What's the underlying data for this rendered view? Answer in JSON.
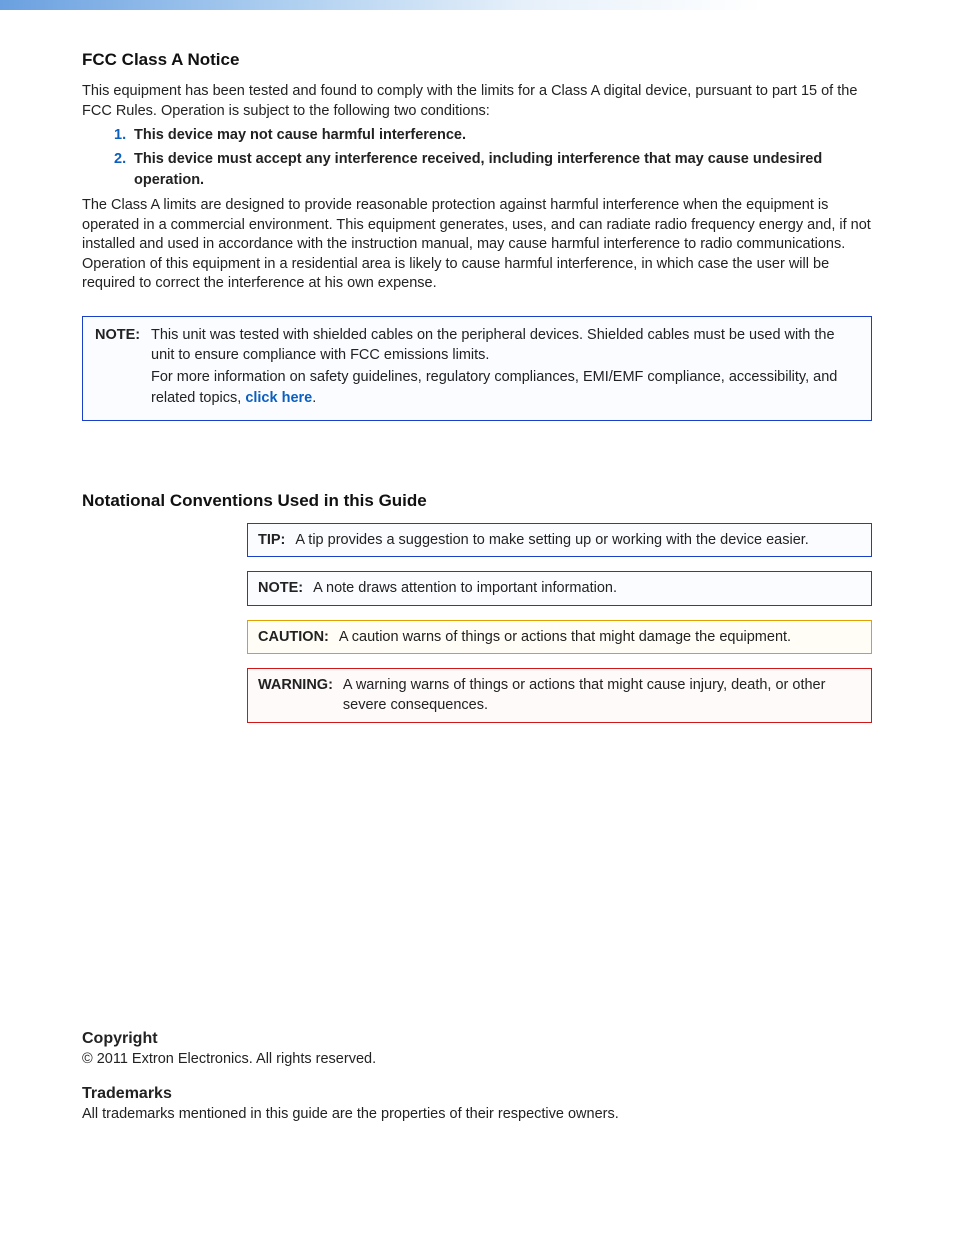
{
  "fcc": {
    "heading": "FCC Class A Notice",
    "intro": "This equipment has been tested and found to comply with the limits for a Class A digital device, pursuant to part 15 of the FCC Rules. Operation is subject to the following two conditions:",
    "cond1_num": "1.",
    "cond1_text": "This device may not cause harmful interference.",
    "cond2_num": "2.",
    "cond2_text": "This device must accept any interference received, including interference that may cause undesired operation.",
    "para2": "The Class A limits are designed to provide reasonable protection against harmful interference when the equipment is operated in a commercial environment. This equipment generates, uses, and can radiate radio frequency energy and, if not installed and used in accordance with the instruction manual, may cause harmful interference to radio communications. Operation of this equipment in a residential area is likely to cause harmful interference, in which case the user will be required to correct the interference at his own expense."
  },
  "note": {
    "label": "NOTE:",
    "line1": "This unit was tested with shielded cables on the peripheral devices. Shielded cables must be used with the unit to ensure compliance with FCC emissions limits.",
    "line2_a": "For more information on safety guidelines, regulatory compliances, EMI/EMF compliance, accessibility, and related topics, ",
    "line2_link": "click here",
    "line2_b": "."
  },
  "conventions": {
    "heading": "Notational Conventions Used in this Guide",
    "tip_label": "TIP:",
    "tip_text": "A tip provides a suggestion to make setting up or working with the device easier.",
    "note_label": "NOTE:",
    "note_text": "A note draws attention to important information.",
    "caution_label": "CAUTION:",
    "caution_text": "A caution warns of things or actions that might damage the equipment.",
    "warning_label": "WARNING:",
    "warning_text": "A warning warns of things or actions that might cause injury, death, or other severe consequences."
  },
  "copyright": {
    "heading": "Copyright",
    "text": "© 2011  Extron Electronics.  All rights reserved."
  },
  "trademarks": {
    "heading": "Trademarks",
    "text": "All trademarks mentioned in this guide are the properties of their respective owners."
  }
}
